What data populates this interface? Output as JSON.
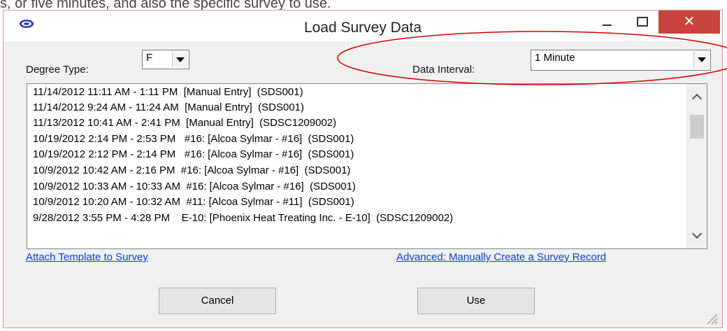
{
  "top_text": "s, or five minutes, and also the specific survey to use.",
  "window": {
    "title": "Load Survey Data",
    "close_glyph": "✕"
  },
  "form": {
    "degree_type_label": "Degree Type:",
    "degree_type_value": "F",
    "data_interval_label": "Data Interval:",
    "data_interval_value": "1 Minute"
  },
  "surveys": [
    "11/14/2012 11:11 AM - 1:11 PM  [Manual Entry]  (SDS001)",
    "11/14/2012 9:24 AM - 11:24 AM  [Manual Entry]  (SDS001)",
    "11/13/2012 10:41 AM - 2:41 PM  [Manual Entry]  (SDSC1209002)",
    "10/19/2012 2:14 PM - 2:53 PM   #16: [Alcoa Sylmar - #16]  (SDS001)",
    "10/19/2012 2:12 PM - 2:14 PM   #16: [Alcoa Sylmar - #16]  (SDS001)",
    "10/9/2012 10:42 AM - 2:16 PM  #16: [Alcoa Sylmar - #16]  (SDS001)",
    "10/9/2012 10:33 AM - 10:33 AM  #16: [Alcoa Sylmar - #16]  (SDS001)",
    "10/9/2012 10:20 AM - 10:32 AM  #11: [Alcoa Sylmar - #11]  (SDS001)",
    "9/28/2012 3:55 PM - 4:28 PM    E-10: [Phoenix Heat Treating Inc. - E-10]  (SDSC1209002)"
  ],
  "links": {
    "attach_template": "Attach Template to Survey",
    "advanced": "Advanced: Manually Create a Survey Record"
  },
  "buttons": {
    "cancel": "Cancel",
    "use": "Use"
  },
  "annotation_color": "#d40000"
}
